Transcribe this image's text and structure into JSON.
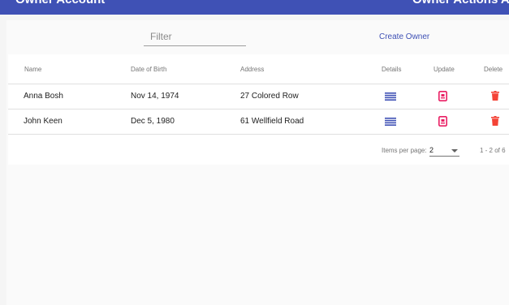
{
  "app": {
    "title": "Owner Account",
    "actions_label": "Owner Actions  Acco"
  },
  "toolbar": {
    "filter_placeholder": "Filter",
    "create_label": "Create Owner"
  },
  "table": {
    "columns": [
      "Name",
      "Date of Birth",
      "Address",
      "Details",
      "Update",
      "Delete"
    ],
    "rows": [
      {
        "name": "Anna Bosh",
        "dob": "Nov 14, 1974",
        "address": "27 Colored Row"
      },
      {
        "name": "John Keen",
        "dob": "Dec 5, 1980",
        "address": "61 Wellfield Road"
      }
    ]
  },
  "paginator": {
    "items_per_page_label": "Items per page:",
    "page_size": "2",
    "range_label": "1 - 2 of 6"
  },
  "colors": {
    "primary": "#3f51b5",
    "accent": "#e91e63",
    "warn": "#f44336"
  },
  "icons": {
    "details": "list-icon",
    "update": "update-icon",
    "delete": "delete-icon"
  }
}
